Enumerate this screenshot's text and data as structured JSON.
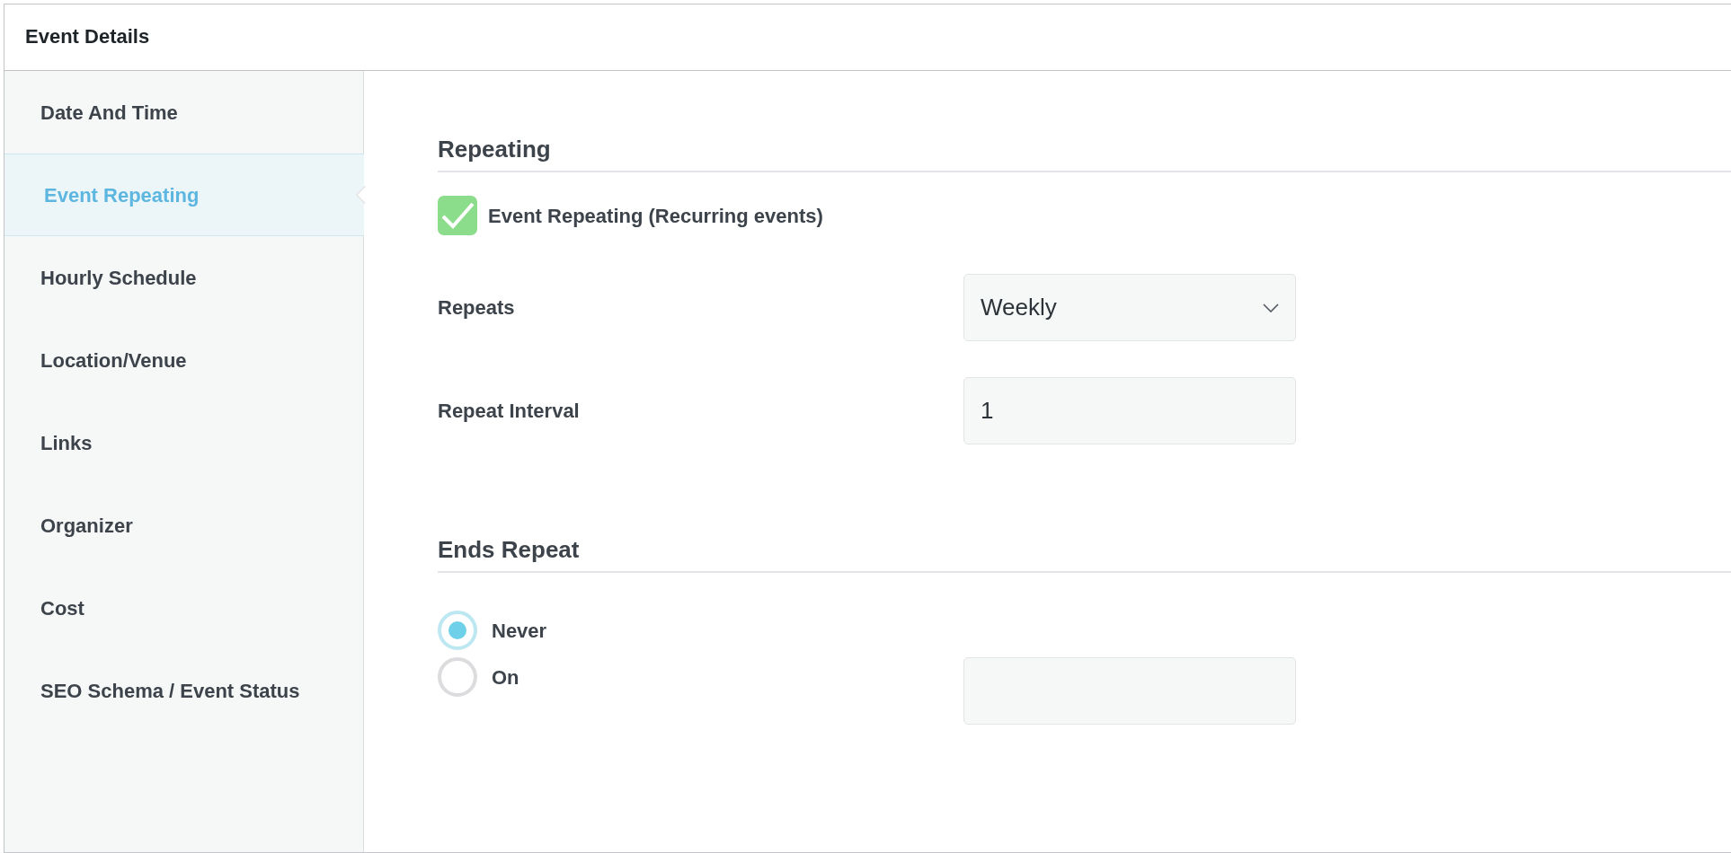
{
  "panel": {
    "title": "Event Details"
  },
  "sidebar": {
    "items": [
      {
        "label": "Date And Time",
        "selected": false
      },
      {
        "label": "Event Repeating",
        "selected": true
      },
      {
        "label": "Hourly Schedule",
        "selected": false
      },
      {
        "label": "Location/Venue",
        "selected": false
      },
      {
        "label": "Links",
        "selected": false
      },
      {
        "label": "Organizer",
        "selected": false
      },
      {
        "label": "Cost",
        "selected": false
      },
      {
        "label": "SEO Schema / Event Status",
        "selected": false
      }
    ]
  },
  "repeating": {
    "heading": "Repeating",
    "enable": {
      "label": "Event Repeating (Recurring events)",
      "checked": true
    },
    "repeats": {
      "label": "Repeats",
      "value": "Weekly"
    },
    "interval": {
      "label": "Repeat Interval",
      "value": "1"
    }
  },
  "ends_repeat": {
    "heading": "Ends Repeat",
    "options": [
      {
        "label": "Never",
        "selected": true,
        "kind": "plain"
      },
      {
        "label": "On",
        "selected": false,
        "kind": "date"
      }
    ]
  }
}
